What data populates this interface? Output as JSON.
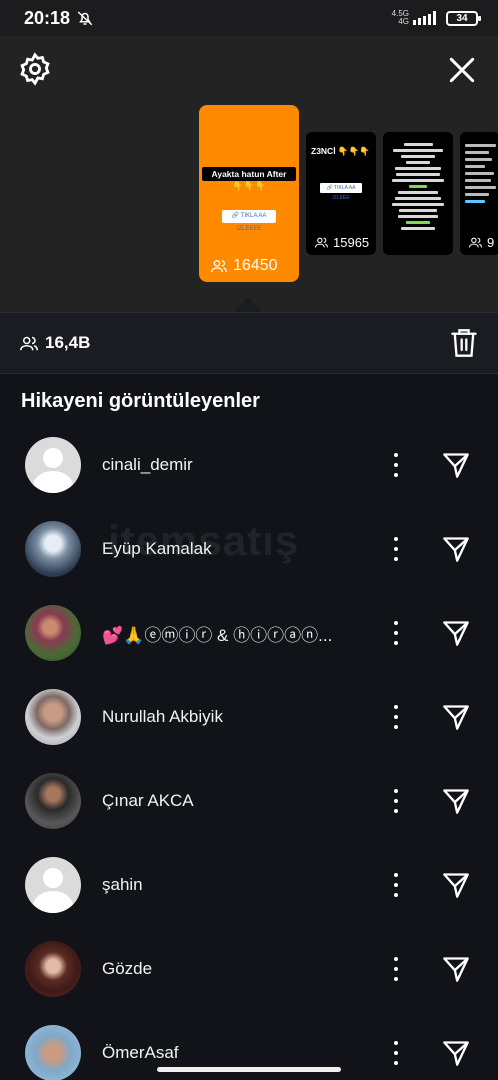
{
  "status_bar": {
    "time": "20:18",
    "network": "4.5G",
    "network_sub": "4G",
    "battery": "34"
  },
  "stories": {
    "main": {
      "caption": "Ayakta hatun After",
      "emoji": "👇👇👇",
      "link_sticker": "🔗 TIKLA AA IZLEEEE",
      "views": "16450"
    },
    "second": {
      "title": "Z3NCİ 👇👇👇",
      "link_sticker": "🔗 TIKLA AA IZLEEE",
      "views": "15965"
    },
    "fourth": {
      "views": "9"
    }
  },
  "summary": {
    "total_viewers": "16,4B"
  },
  "section_title": "Hikayeni görüntüleyenler",
  "viewers": [
    {
      "username": "cinali_demir",
      "avatar": "default"
    },
    {
      "username": "Eyüp Kamalak",
      "avatar": "photo"
    },
    {
      "username": "💕🙏ⓔⓜⓘⓡ & ⓗⓘⓡⓐⓝ...",
      "avatar": "photo"
    },
    {
      "username": "Nurullah Akbiyik",
      "avatar": "photo"
    },
    {
      "username": "Çınar AKCA",
      "avatar": "photo"
    },
    {
      "username": "şahin",
      "avatar": "default"
    },
    {
      "username": "Gözde",
      "avatar": "photo"
    },
    {
      "username": "ÖmerAsaf",
      "avatar": "photo"
    }
  ],
  "watermark": "itemsatış"
}
